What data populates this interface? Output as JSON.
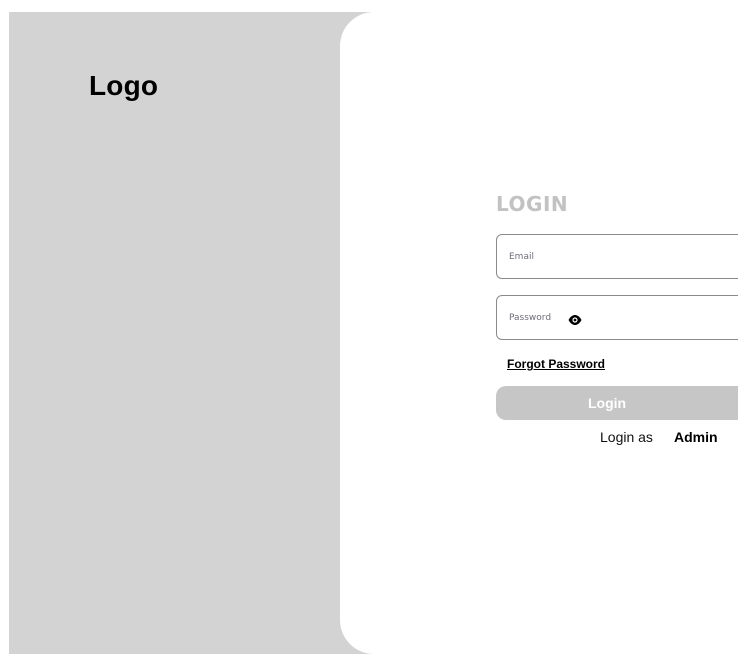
{
  "brand": {
    "logo_text": "Logo"
  },
  "login_form": {
    "title": "LOGIN",
    "email_placeholder": "Email",
    "password_placeholder": "Password",
    "password_toggle_icon": "eye-icon",
    "forgot_password_label": "Forgot Password",
    "submit_label": "Login",
    "login_as_label": "Login as",
    "admin_label": "Admin"
  },
  "colors": {
    "sidebar_background": "#d3d3d3",
    "panel_background": "#ffffff",
    "title_color": "#c2c2c2",
    "button_background": "#c6c6c6",
    "button_text": "#ffffff"
  }
}
